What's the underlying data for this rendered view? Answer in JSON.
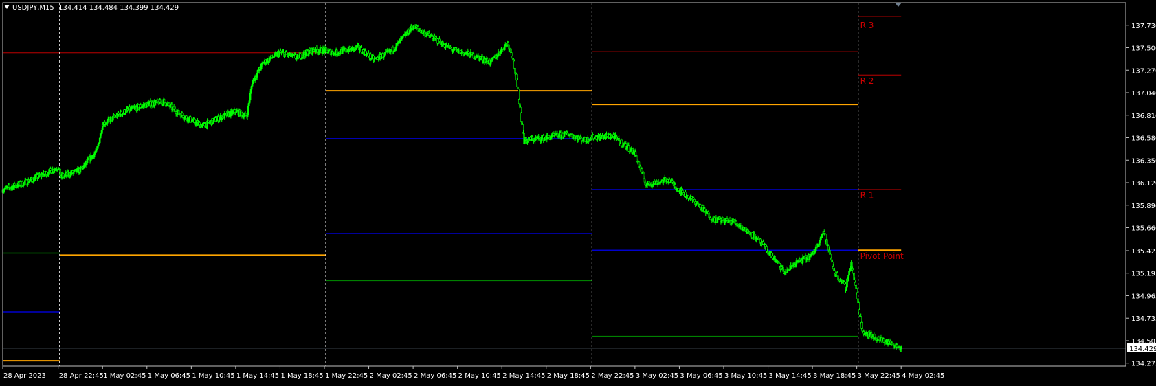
{
  "header": {
    "symbol": "USDJPY,M15",
    "ohlc": "134.414 134.484 134.399 134.429"
  },
  "colors": {
    "background": "#000000",
    "grid_frame": "#c0c0c0",
    "candle": "#00ff00",
    "pivot": "#ffa500",
    "resistance": "#8b0000",
    "support_blue": "#0000cd",
    "support_green": "#008000",
    "separator": "#ffffff",
    "bid_line": "#708090",
    "label_red": "#cc0000"
  },
  "chart_data": {
    "type": "candlestick",
    "symbol": "USDJPY",
    "timeframe": "M15",
    "ylim": [
      134.245,
      137.96
    ],
    "y_ticks": [
      137.73,
      137.5,
      137.27,
      137.04,
      136.81,
      136.58,
      136.35,
      136.12,
      135.89,
      135.66,
      135.425,
      135.195,
      134.965,
      134.735,
      134.505,
      134.275
    ],
    "y_tick_labels": [
      "137.730",
      "137.500",
      "137.270",
      "137.040",
      "136.810",
      "136.580",
      "136.350",
      "136.120",
      "135.890",
      "135.660",
      "135.425",
      "135.195",
      "134.965",
      "134.735",
      "134.505",
      "134.275"
    ],
    "current_price": 134.429,
    "current_price_label": "134.429",
    "x_labels": [
      "28 Apr 2023",
      "28 Apr 22:45",
      "1 May 02:45",
      "1 May 06:45",
      "1 May 10:45",
      "1 May 14:45",
      "1 May 18:45",
      "1 May 22:45",
      "2 May 02:45",
      "2 May 06:45",
      "2 May 10:45",
      "2 May 14:45",
      "2 May 18:45",
      "2 May 22:45",
      "3 May 02:45",
      "3 May 06:45",
      "3 May 10:45",
      "3 May 14:45",
      "3 May 18:45",
      "3 May 22:45",
      "4 May 02:45"
    ],
    "bar_index_range": [
      0,
      405
    ],
    "x_label_bars": [
      0,
      20,
      36,
      52,
      68,
      84,
      100,
      116,
      132,
      148,
      164,
      180,
      196,
      212,
      228,
      244,
      260,
      276,
      292,
      308,
      324
    ],
    "day_separator_bars": [
      20.5,
      116.5,
      212.5,
      308.5
    ],
    "close_path": [
      [
        0,
        136.05
      ],
      [
        8,
        136.12
      ],
      [
        16,
        136.22
      ],
      [
        20,
        136.28
      ],
      [
        21,
        136.18
      ],
      [
        28,
        136.25
      ],
      [
        34,
        136.45
      ],
      [
        36,
        136.72
      ],
      [
        44,
        136.85
      ],
      [
        52,
        136.92
      ],
      [
        58,
        136.95
      ],
      [
        64,
        136.82
      ],
      [
        72,
        136.7
      ],
      [
        78,
        136.78
      ],
      [
        84,
        136.85
      ],
      [
        88,
        136.8
      ],
      [
        90,
        137.15
      ],
      [
        94,
        137.35
      ],
      [
        100,
        137.45
      ],
      [
        106,
        137.4
      ],
      [
        112,
        137.48
      ],
      [
        116,
        137.47
      ],
      [
        120,
        137.45
      ],
      [
        128,
        137.5
      ],
      [
        134,
        137.38
      ],
      [
        140,
        137.46
      ],
      [
        148,
        137.72
      ],
      [
        154,
        137.62
      ],
      [
        162,
        137.48
      ],
      [
        170,
        137.42
      ],
      [
        176,
        137.35
      ],
      [
        182,
        137.55
      ],
      [
        184,
        137.4
      ],
      [
        186,
        137.0
      ],
      [
        188,
        136.55
      ],
      [
        196,
        136.58
      ],
      [
        204,
        136.62
      ],
      [
        210,
        136.55
      ],
      [
        212,
        136.58
      ],
      [
        220,
        136.6
      ],
      [
        228,
        136.42
      ],
      [
        232,
        136.1
      ],
      [
        240,
        136.15
      ],
      [
        246,
        136.0
      ],
      [
        250,
        135.92
      ],
      [
        256,
        135.75
      ],
      [
        264,
        135.72
      ],
      [
        272,
        135.55
      ],
      [
        278,
        135.35
      ],
      [
        282,
        135.2
      ],
      [
        286,
        135.3
      ],
      [
        292,
        135.38
      ],
      [
        296,
        135.62
      ],
      [
        300,
        135.2
      ],
      [
        304,
        135.05
      ],
      [
        306,
        135.3
      ],
      [
        308,
        134.98
      ],
      [
        310,
        134.6
      ],
      [
        316,
        134.52
      ],
      [
        320,
        134.48
      ],
      [
        324,
        134.43
      ]
    ],
    "pivot_levels": {
      "days": [
        {
          "from": 0,
          "to": 20.5,
          "R3": null,
          "R2": null,
          "R1": 137.45,
          "PP": 134.3,
          "S1": 134.8,
          "S2": null,
          "S3": 135.4
        },
        {
          "from": 20.5,
          "to": 116.5,
          "R1": 137.45,
          "PP": 135.38,
          "S1": null,
          "S2": null,
          "S3": null
        },
        {
          "from": 116.5,
          "to": 212.5,
          "R1": null,
          "PP": 137.06,
          "S1": 136.57,
          "S2": 135.6,
          "S3": 135.12
        },
        {
          "from": 212.5,
          "to": 308.5,
          "R1": 137.46,
          "PP": 136.92,
          "S1": 136.05,
          "S2": 135.43,
          "S3": 134.55
        },
        {
          "from": 308.5,
          "to": 324,
          "R3": 137.82,
          "R2": 137.22,
          "R1": 136.05,
          "PP": 135.43
        }
      ]
    },
    "level_labels": [
      {
        "text": "R 3",
        "price": 137.73
      },
      {
        "text": "R 2",
        "price": 137.16
      },
      {
        "text": "R 1",
        "price": 135.99
      },
      {
        "text": "Pivot Point",
        "price": 135.37
      }
    ]
  }
}
